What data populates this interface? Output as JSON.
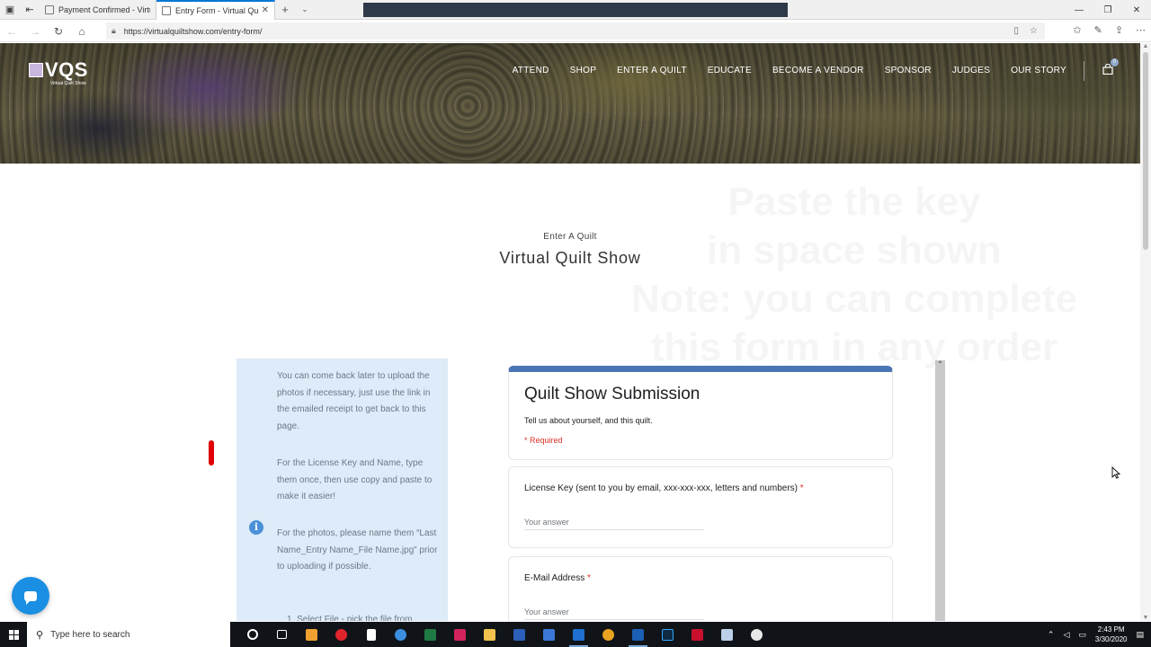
{
  "browser": {
    "tabs": [
      {
        "label": "Payment Confirmed - Virtua",
        "active": false
      },
      {
        "label": "Entry Form - Virtual Qui",
        "active": true
      }
    ],
    "url": "https://virtualquiltshow.com/entry-form/"
  },
  "site": {
    "logo_text": "VQS",
    "logo_sub": "Virtual Quilt Show",
    "nav": [
      "ATTEND",
      "SHOP",
      "ENTER A QUILT",
      "EDUCATE",
      "BECOME A VENDOR",
      "SPONSOR",
      "JUDGES",
      "OUR STORY"
    ],
    "cart_count": "0"
  },
  "overlay_text": [
    "Paste the key",
    "in space shown",
    "Note: you can complete",
    "this form in any order"
  ],
  "page": {
    "eyebrow": "Enter A Quilt",
    "title": "Virtual Quilt Show"
  },
  "info": {
    "p1": "You can come back later to upload the photos if necessary, just use the link in the emailed receipt to get back to this page.",
    "p2": "For the License Key and Name, type them once, then use copy and paste to make it easier!",
    "p3": "For the photos, please name them “Last Name_Entry Name_File Name.jpg” prior to uploading if possible.",
    "p4": "1. Select File - pick the file from"
  },
  "form": {
    "title": "Quilt Show Submission",
    "description": "Tell us about yourself, and this quilt.",
    "required_note": "* Required",
    "q1_label": "License Key (sent to you by email, xxx-xxx-xxx, letters and numbers)",
    "q2_label": "E-Mail Address",
    "required_star": "*",
    "answer_placeholder": "Your answer"
  },
  "taskbar": {
    "search_placeholder": "Type here to search",
    "time": "2:43 PM",
    "date": "3/30/2020"
  },
  "colors": {
    "form_accent": "#4a76b5",
    "info_bg": "#deebf8",
    "required_red": "#d93025",
    "chat_blue": "#1a8fe3"
  }
}
